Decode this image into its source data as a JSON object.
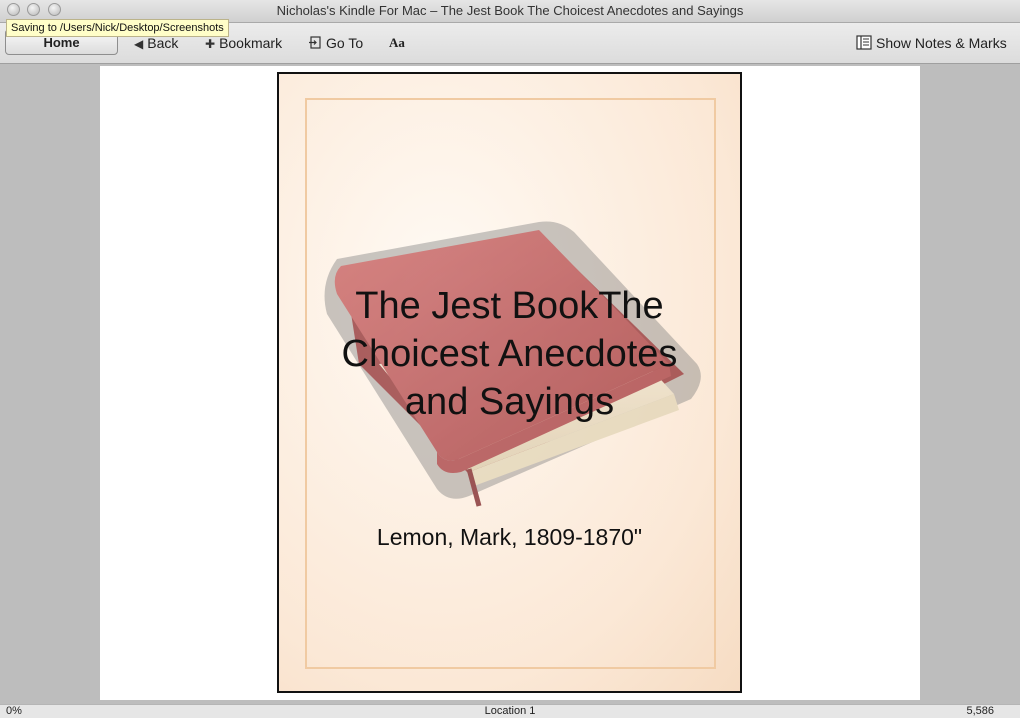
{
  "window": {
    "title": "Nicholas's Kindle For Mac – The Jest Book The Choicest Anecdotes and Sayings",
    "tooltip": "Saving to /Users/Nick/Desktop/Screenshots"
  },
  "toolbar": {
    "home_label": "Home",
    "back_label": "Back",
    "bookmark_label": "Bookmark",
    "goto_label": "Go To",
    "font_label": "Aa",
    "notes_label": "Show Notes & Marks"
  },
  "cover": {
    "title_line1": "The Jest BookThe",
    "title_line2": "Choicest Anecdotes",
    "title_line3": "and Sayings",
    "author": "Lemon, Mark, 1809-1870\""
  },
  "status": {
    "progress": "0%",
    "location": "Location 1",
    "total": "5,586"
  },
  "colors": {
    "chrome": "#dcdcdc",
    "cover_bg": "#fbe8d6",
    "book_red": "#b8474a"
  }
}
